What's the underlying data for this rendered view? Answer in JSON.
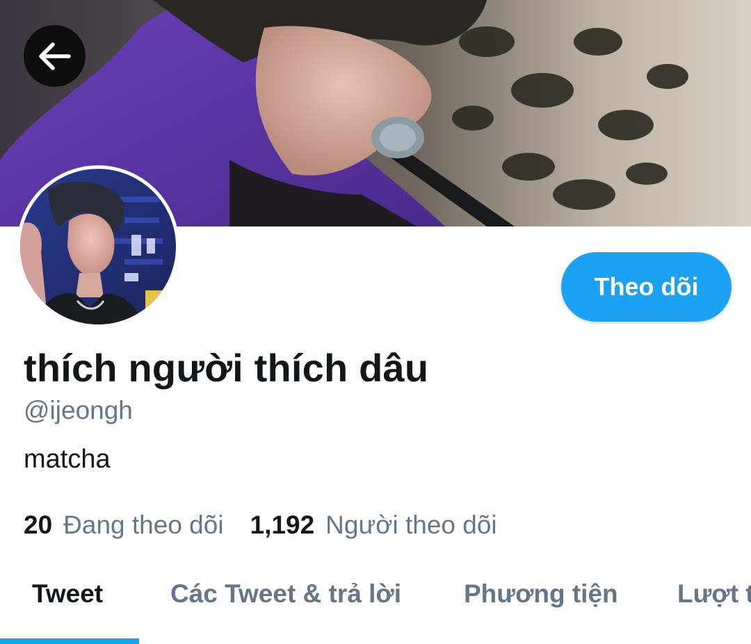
{
  "profile": {
    "display_name": "thích người thích dâu",
    "handle": "@ijeongh",
    "bio": "matcha"
  },
  "actions": {
    "follow_label": "Theo dõi",
    "back_icon": "arrow-left-icon"
  },
  "stats": {
    "following_count": "20",
    "following_label": "Đang theo dõi",
    "followers_count": "1,192",
    "followers_label": "Người theo dõi"
  },
  "tabs": [
    {
      "label": "Tweet",
      "active": true
    },
    {
      "label": "Các Tweet & trả lời",
      "active": false
    },
    {
      "label": "Phương tiện",
      "active": false
    },
    {
      "label": "Lượt thích",
      "active": false
    }
  ],
  "colors": {
    "accent": "#1da1f2",
    "text_primary": "#14171a",
    "text_secondary": "#657786"
  }
}
